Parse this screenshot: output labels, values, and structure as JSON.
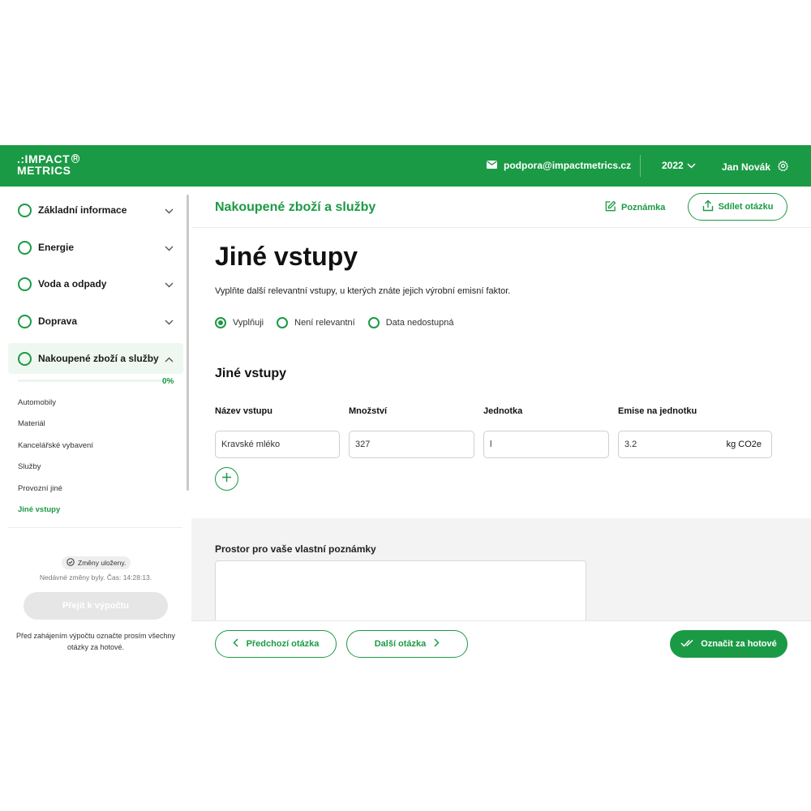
{
  "header": {
    "logo_line1": ".:IMPACT",
    "logo_reg": "R",
    "logo_line2": "METRICS",
    "support_email": "podpora@impactmetrics.cz",
    "year": "2022",
    "user_name": "Jan Novák"
  },
  "sidebar": {
    "sections": [
      {
        "label": "Základní informace"
      },
      {
        "label": "Energie"
      },
      {
        "label": "Voda a odpady"
      },
      {
        "label": "Doprava"
      },
      {
        "label": "Nakoupené zboží a služby"
      }
    ],
    "progress_label": "0%",
    "progress_value": 0,
    "subitems": [
      "Automobily",
      "Materiál",
      "Kancelářské vybavení",
      "Služby",
      "Provozní jiné",
      "Jiné vstupy"
    ],
    "saved_badge": "Změny uloženy.",
    "saved_note": "Nedávné změny byly. Čas: 14:28:13.",
    "calc_button": "Přejít k výpočtu",
    "calc_note": "Před zahájením výpočtu označte prosím všechny otázky za hotové."
  },
  "main": {
    "section_title": "Nakoupené zboží a služby",
    "note_link": "Poznámka",
    "share_button": "Sdílet otázku",
    "question_title": "Jiné vstupy",
    "question_desc": "Vyplňte další relevantní vstupy, u kterých znáte jejich výrobní emisní faktor.",
    "radio_options": [
      "Vyplňuji",
      "Není relevantní",
      "Data nedostupná"
    ],
    "radio_selected": "Vyplňuji",
    "subsection_title": "Jiné vstupy",
    "columns": [
      "Název vstupu",
      "Množství",
      "Jednotka",
      "Emise na jednotku"
    ],
    "row": {
      "name": "Kravské mléko",
      "quantity": "327",
      "unit": "l",
      "emission": "3.2",
      "emission_unit": "kg CO2e"
    },
    "notes_label": "Prostor pro vaše vlastní poznámky",
    "notes_value": "",
    "prev_button": "Předchozí otázka",
    "next_button": "Další otázka",
    "done_button": "Označit za hotové"
  },
  "colors": {
    "brand": "#1b9a45",
    "brand_light": "#eef8f1",
    "gray_area": "#f3f3f3"
  }
}
